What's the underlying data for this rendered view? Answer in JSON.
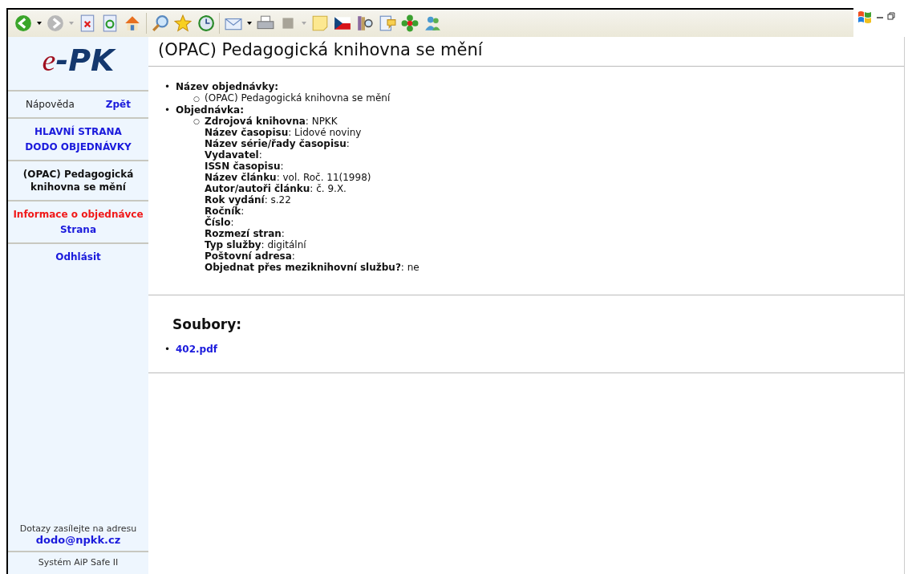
{
  "sidebar": {
    "logo_e": "e",
    "logo_rest": "-PK",
    "help": "Nápověda",
    "back": "Zpět",
    "menu": [
      {
        "lines": [
          {
            "text": "HLAVNÍ STRANA",
            "kind": "link"
          },
          {
            "text": "DODO OBJEDNÁVKY",
            "kind": "link"
          }
        ]
      },
      {
        "lines": [
          {
            "text": "(OPAC) Pedagogická knihovna se mění",
            "kind": "current"
          }
        ]
      },
      {
        "lines": [
          {
            "text": "Informace o objednávce",
            "kind": "active"
          },
          {
            "text": "Strana",
            "kind": "link"
          }
        ]
      },
      {
        "lines": [
          {
            "text": "Odhlásit",
            "kind": "link"
          }
        ]
      }
    ],
    "contact_text": "Dotazy zasílejte na adresu",
    "contact_email": "dodo@npkk.cz",
    "system": "Systém AiP Safe II"
  },
  "page_title": "(OPAC) Pedagogická knihovna se mění",
  "order_name_bullet": "•",
  "order_name_label": "Název objednávky:",
  "order_name_sub_bullet": "○",
  "order_name": "(OPAC) Pedagogická knihovna se mění",
  "order_bullet": "•",
  "order_label": "Objednávka:",
  "order_sub_bullet": "○",
  "order_fields": [
    "**Zdrojová knihovna**: NPKK",
    "**Název časopisu**: Lidové noviny",
    "**Název série/řady časopisu**:",
    "**Vydavatel**:",
    "**ISSN časopisu**:",
    "**Název článku**: vol. Roč. 11(1998)",
    "**Autor/autoři článku**: č. 9.X.",
    "**Rok vydání**: s.22",
    "**Ročník**:",
    "**Číslo**:",
    "**Rozmezí stran**:",
    "**Typ služby**: digitální",
    "**Poštovní adresa**:",
    "**Objednat přes meziknihovní službu?**: ne"
  ],
  "files_heading": "Soubory:",
  "files": [
    {
      "bullet": "•",
      "name": "402.pdf"
    }
  ]
}
